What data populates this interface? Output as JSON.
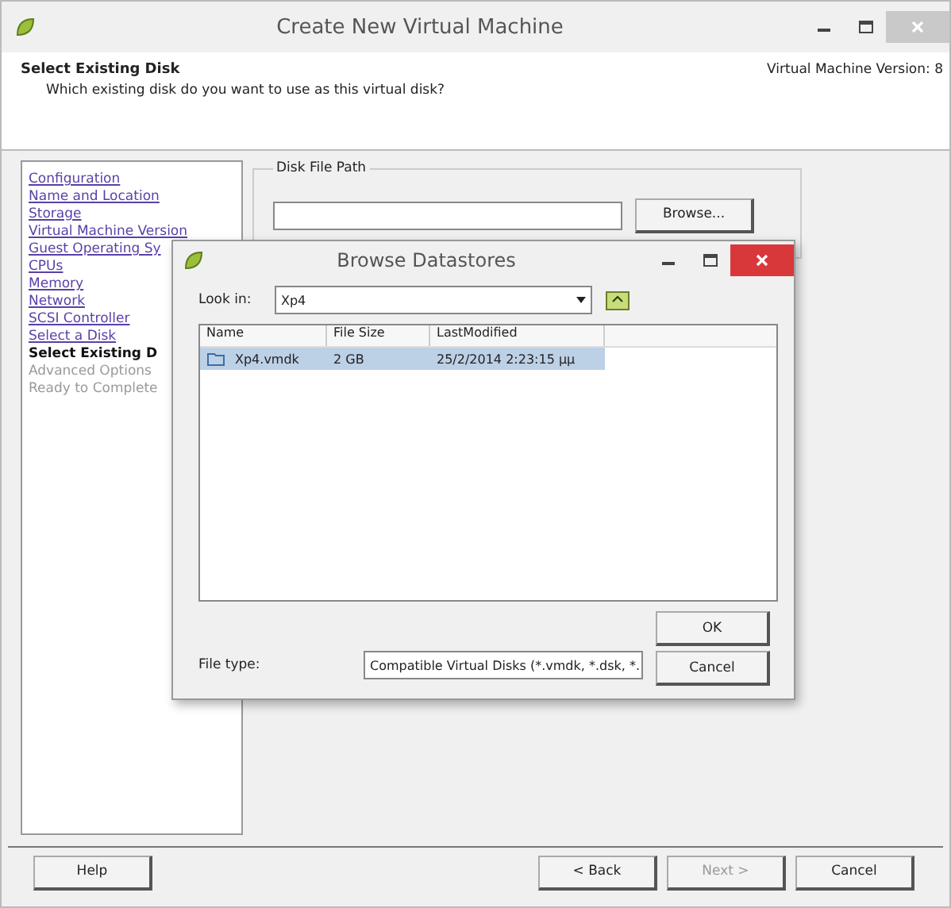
{
  "window": {
    "title": "Create New Virtual Machine"
  },
  "header": {
    "title": "Select Existing Disk",
    "subtitle": "Which existing disk do you want to use as this virtual disk?",
    "version": "Virtual Machine Version: 8"
  },
  "steps": [
    {
      "label": "Configuration",
      "visited": true,
      "selected": false
    },
    {
      "label": "Name and Location",
      "visited": true,
      "selected": false
    },
    {
      "label": "Storage",
      "visited": true,
      "selected": false
    },
    {
      "label": "Virtual Machine Version",
      "visited": true,
      "selected": false
    },
    {
      "label": "Guest Operating Sy",
      "visited": true,
      "selected": false
    },
    {
      "label": "CPUs",
      "visited": true,
      "selected": false
    },
    {
      "label": "Memory",
      "visited": true,
      "selected": false
    },
    {
      "label": "Network",
      "visited": true,
      "selected": false
    },
    {
      "label": "SCSI Controller",
      "visited": true,
      "selected": false
    },
    {
      "label": "Select a Disk",
      "visited": true,
      "selected": false
    },
    {
      "label": "Select Existing D",
      "visited": false,
      "selected": true
    },
    {
      "label": "Advanced Options",
      "visited": false,
      "selected": false
    },
    {
      "label": "Ready to Complete",
      "visited": false,
      "selected": false
    }
  ],
  "disk_path": {
    "legend": "Disk File Path",
    "browse": "Browse..."
  },
  "footer": [
    {
      "label": "Help",
      "disabled": false
    },
    {
      "label": "< Back",
      "disabled": false
    },
    {
      "label": "Next >",
      "disabled": true
    },
    {
      "label": "Cancel",
      "disabled": false
    }
  ],
  "dialog": {
    "title": "Browse Datastores",
    "look_in_label": "Look in:",
    "look_in": "Xp4",
    "columns": [
      "Name",
      "File Size",
      "LastModified"
    ],
    "rows": [
      {
        "name": "Xp4.vmdk",
        "size": "2 GB",
        "modified": "25/2/2014 2:23:15 μμ",
        "selected": true
      }
    ],
    "file_type_label": "File type:",
    "file_type": "Compatible Virtual Disks (*.vmdk, *.dsk, *.",
    "ok": "OK",
    "cancel": "Cancel"
  }
}
